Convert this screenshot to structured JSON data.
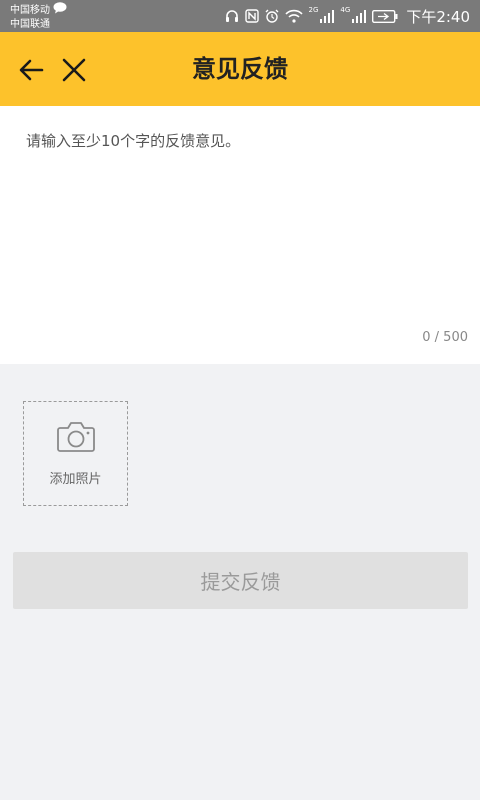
{
  "status_bar": {
    "carrier_1": "中国移动",
    "carrier_2": "中国联通",
    "network_1": "2G",
    "network_2": "4G",
    "time": "下午2:40"
  },
  "header": {
    "title": "意见反馈",
    "background_color": "#fdc22b"
  },
  "feedback": {
    "placeholder": "请输入至少10个字的反馈意见。",
    "value": "",
    "counter": "0 / 500"
  },
  "add_photo": {
    "label": "添加照片"
  },
  "submit": {
    "label": "提交反馈"
  },
  "icons": {
    "back": "arrow-left-icon",
    "close": "close-icon",
    "camera": "camera-icon"
  }
}
